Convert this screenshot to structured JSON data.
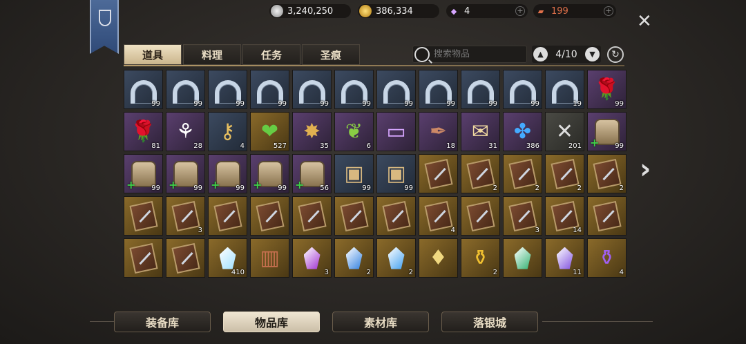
{
  "currencies": [
    {
      "icon": "silver-coin-icon",
      "value": "3,240,250"
    },
    {
      "icon": "gold-coin-icon",
      "value": "386,334"
    },
    {
      "icon": "diamond-icon",
      "value": "4"
    },
    {
      "icon": "ticket-icon",
      "value": "199"
    }
  ],
  "tabs": [
    "道具",
    "料理",
    "任务",
    "圣痕"
  ],
  "search": {
    "placeholder": "搜索物品"
  },
  "pager": {
    "text": "4/10"
  },
  "grid": [
    [
      {
        "t": "horseshoe",
        "c": "99"
      },
      {
        "t": "horseshoe",
        "c": "99"
      },
      {
        "t": "horseshoe",
        "c": "99"
      },
      {
        "t": "horseshoe",
        "c": "99"
      },
      {
        "t": "horseshoe",
        "c": "99"
      },
      {
        "t": "horseshoe",
        "c": "99"
      },
      {
        "t": "horseshoe",
        "c": "99"
      },
      {
        "t": "horseshoe",
        "c": "99"
      },
      {
        "t": "horseshoe",
        "c": "99"
      },
      {
        "t": "horseshoe",
        "c": "99"
      },
      {
        "t": "horseshoe",
        "c": "19"
      },
      {
        "t": "rose",
        "c": "99"
      }
    ],
    [
      {
        "t": "rose",
        "c": "81"
      },
      {
        "t": "lily",
        "c": "28"
      },
      {
        "t": "bone-key",
        "c": "4"
      },
      {
        "t": "heart-pendant",
        "c": "527"
      },
      {
        "t": "medal",
        "c": "35"
      },
      {
        "t": "olive",
        "c": "6"
      },
      {
        "t": "ticket",
        "c": ""
      },
      {
        "t": "quill",
        "c": "18"
      },
      {
        "t": "letter",
        "c": "31"
      },
      {
        "t": "butterfly",
        "c": "386"
      },
      {
        "t": "scroll-box",
        "c": "201"
      },
      {
        "t": "bag",
        "c": "99"
      }
    ],
    [
      {
        "t": "bag",
        "c": "99"
      },
      {
        "t": "bag",
        "c": "99"
      },
      {
        "t": "bag",
        "c": "99"
      },
      {
        "t": "bag",
        "c": "99"
      },
      {
        "t": "bag",
        "c": "56"
      },
      {
        "t": "crate",
        "c": "99"
      },
      {
        "t": "crate",
        "c": "99"
      },
      {
        "t": "book",
        "c": ""
      },
      {
        "t": "book",
        "c": "2"
      },
      {
        "t": "book",
        "c": "2"
      },
      {
        "t": "book",
        "c": "2"
      },
      {
        "t": "book",
        "c": "2"
      }
    ],
    [
      {
        "t": "book",
        "c": ""
      },
      {
        "t": "book",
        "c": "3"
      },
      {
        "t": "book",
        "c": ""
      },
      {
        "t": "book",
        "c": ""
      },
      {
        "t": "book",
        "c": ""
      },
      {
        "t": "book",
        "c": ""
      },
      {
        "t": "book",
        "c": ""
      },
      {
        "t": "book",
        "c": "4"
      },
      {
        "t": "book",
        "c": ""
      },
      {
        "t": "book",
        "c": "3"
      },
      {
        "t": "book",
        "c": "14"
      },
      {
        "t": "book",
        "c": ""
      }
    ],
    [
      {
        "t": "book",
        "c": ""
      },
      {
        "t": "book",
        "c": ""
      },
      {
        "t": "crystal",
        "c": "410"
      },
      {
        "t": "wood",
        "c": ""
      },
      {
        "t": "purple-gem",
        "c": "3"
      },
      {
        "t": "blue-gem",
        "c": "2"
      },
      {
        "t": "teal-crystal",
        "c": "2"
      },
      {
        "t": "gold-crystal",
        "c": ""
      },
      {
        "t": "yellow-potion",
        "c": "2"
      },
      {
        "t": "green-gem",
        "c": ""
      },
      {
        "t": "violet-shard",
        "c": "11"
      },
      {
        "t": "purple-potion",
        "c": "4"
      }
    ]
  ],
  "bottom_tabs": [
    "装备库",
    "物品库",
    "素材库",
    "落银城"
  ]
}
